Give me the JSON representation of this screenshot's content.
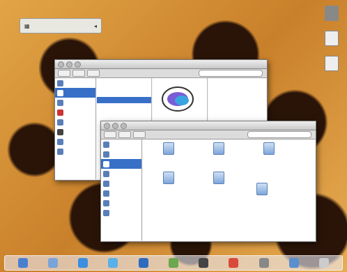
{
  "desktop": {
    "widget_label": "",
    "icons": [
      {
        "name": "hard-drive-icon",
        "label": ""
      },
      {
        "name": "document-icon",
        "label": ""
      },
      {
        "name": "text-file-icon",
        "label": ""
      }
    ]
  },
  "back_window": {
    "title": "",
    "sidebar_count": 8,
    "column_rows": [
      "",
      "",
      "",
      "",
      "",
      ""
    ]
  },
  "front_window": {
    "title": "",
    "files": [
      {
        "label": ""
      },
      {
        "label": ""
      },
      {
        "label": ""
      },
      {
        "label": ""
      },
      {
        "label": ""
      },
      {
        "label": ""
      }
    ]
  },
  "colors": {
    "selection": "#3870c8",
    "dock": "#ebebf5"
  },
  "dock": {
    "items": [
      "finder-icon",
      "mail-icon",
      "safari-icon",
      "ichat-icon",
      "itunes-icon",
      "iphoto-icon",
      "imovie-icon",
      "ical-icon",
      "preferences-icon",
      "folder-icon",
      "trash-icon"
    ]
  }
}
